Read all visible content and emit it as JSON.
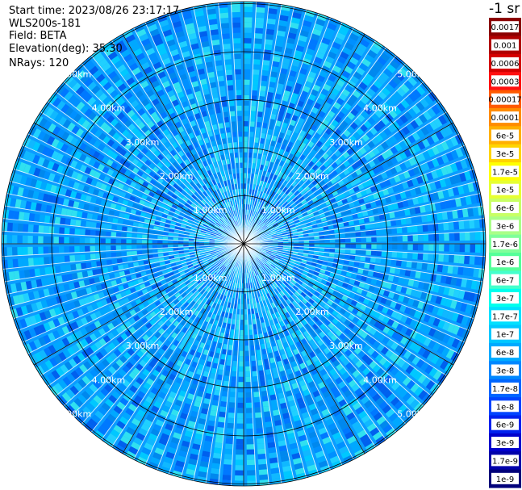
{
  "info": {
    "start_time": "Start time: 2023/08/26 23:17:17",
    "instrument": "WLS200s-181",
    "field": "Field: BETA",
    "elevation": "Elevation(deg): 35.30",
    "nrays": "NRays: 120"
  },
  "chart_data": {
    "type": "heatmap",
    "projection": "polar",
    "range_rings_km": [
      1,
      2,
      3,
      4,
      5
    ],
    "ring_labels": [
      "1.00km",
      "2.00km",
      "3.00km",
      "4.00km",
      "5.00km"
    ],
    "radial_spokes": 12,
    "nrays": 120,
    "colorbar": {
      "unit_label": "-1 sr",
      "tick_labels": [
        "0.0017",
        "0.001",
        "0.0006",
        "0.0003",
        "0.00017",
        "0.0001",
        "6e-5",
        "3e-5",
        "1.7e-5",
        "1e-5",
        "6e-6",
        "3e-6",
        "1.7e-6",
        "1e-6",
        "6e-7",
        "3e-7",
        "1.7e-7",
        "1e-7",
        "6e-8",
        "3e-8",
        "1.7e-8",
        "1e-8",
        "6e-9",
        "3e-9",
        "1.7e-9",
        "1e-9"
      ],
      "colors": [
        "#8b0000",
        "#b00000",
        "#d40000",
        "#ff1010",
        "#ff5a00",
        "#ff8c00",
        "#ffb000",
        "#ffd400",
        "#ffff00",
        "#e6ff33",
        "#c8ff66",
        "#aaff88",
        "#80ff99",
        "#55ff99",
        "#44ffcc",
        "#00ffee",
        "#00e0ff",
        "#00c8ff",
        "#00aaff",
        "#0088ff",
        "#0066ff",
        "#0044ff",
        "#0022ee",
        "#0000cc",
        "#0000aa",
        "#00007a"
      ]
    }
  }
}
